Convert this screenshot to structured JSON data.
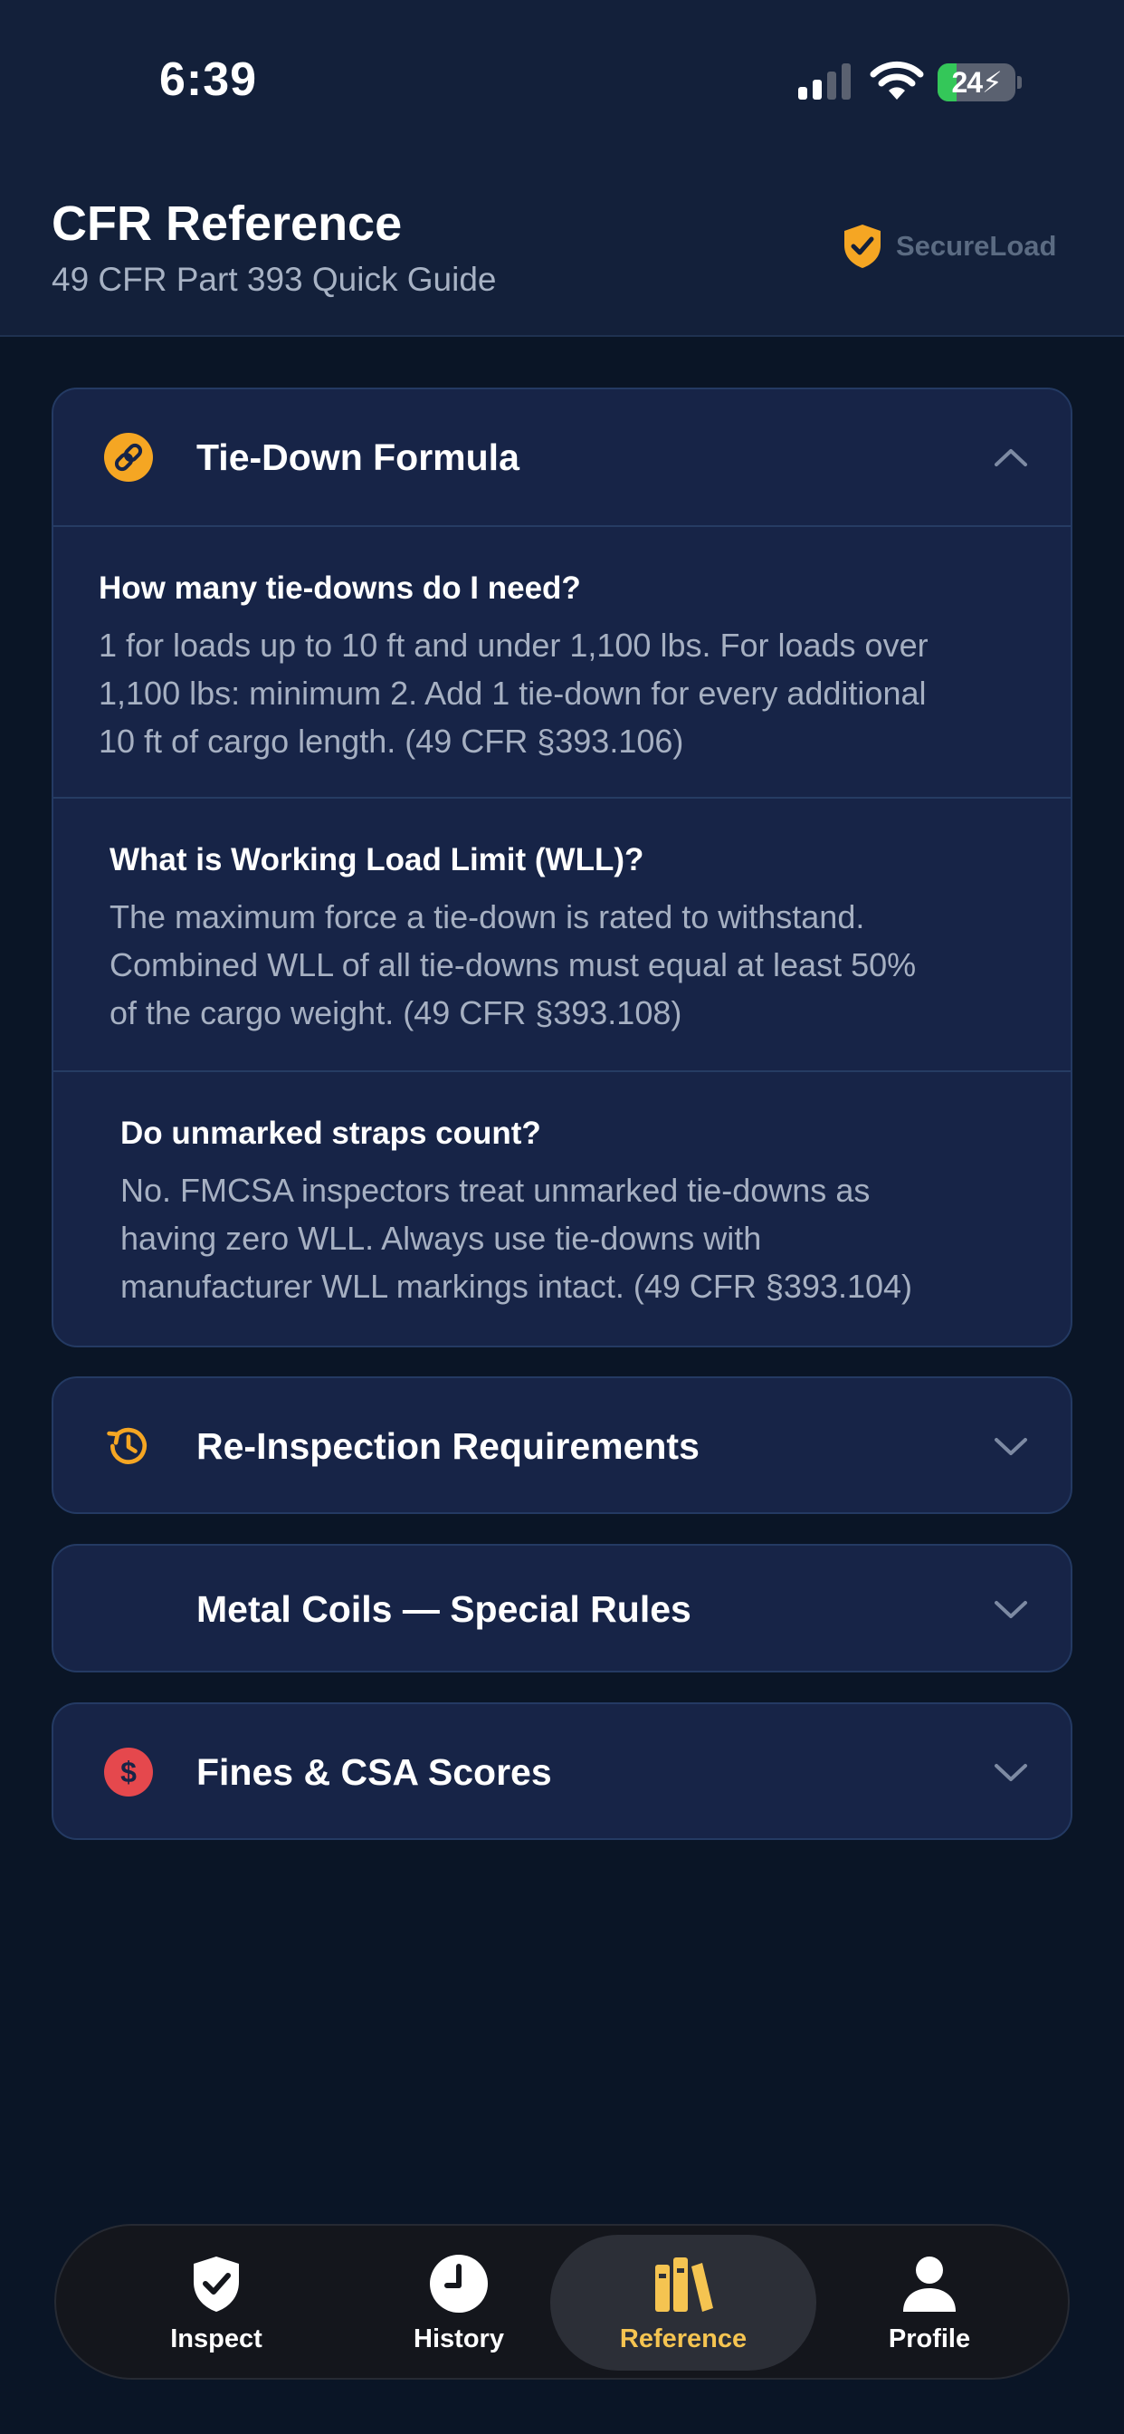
{
  "status": {
    "time": "6:39",
    "battery_level": "24",
    "battery_fraction": 0.24
  },
  "header": {
    "title": "CFR Reference",
    "subtitle": "49 CFR Part 393 Quick Guide",
    "brand": "SecureLoad"
  },
  "colors": {
    "accent": "#f5a623",
    "danger": "#e5484d",
    "active_tab": "#f5c451",
    "card_bg": "#172447"
  },
  "sections": [
    {
      "title": "Tie-Down Formula",
      "icon": "link-icon",
      "expanded": true,
      "items": [
        {
          "question": "How many tie-downs do I need?",
          "answer_lines": [
            "1 for loads up to 10 ft and under 1,100 lbs. For loads over",
            "1,100 lbs: minimum 2. Add 1 tie-down for every additional",
            "10 ft of cargo length. (49 CFR §393.106)"
          ]
        },
        {
          "question": "What is Working Load Limit (WLL)?",
          "answer_lines": [
            "The maximum force a tie-down is rated to withstand.",
            "Combined WLL of all tie-downs must equal at least 50%",
            "of the cargo weight. (49 CFR §393.108)"
          ]
        },
        {
          "question": "Do unmarked straps count?",
          "answer_lines": [
            "No. FMCSA inspectors treat unmarked tie-downs as",
            "having zero WLL. Always use tie-downs with",
            "manufacturer WLL markings intact. (49 CFR §393.104)"
          ]
        }
      ]
    },
    {
      "title": "Re-Inspection Requirements",
      "icon": "history-icon",
      "expanded": false
    },
    {
      "title": "Metal Coils — Special Rules",
      "icon": "",
      "expanded": false
    },
    {
      "title": "Fines & CSA Scores",
      "icon": "dollar-icon",
      "expanded": false
    }
  ],
  "tabs": [
    {
      "label": "Inspect",
      "icon": "shield-check-icon",
      "active": false
    },
    {
      "label": "History",
      "icon": "clock-icon",
      "active": false
    },
    {
      "label": "Reference",
      "icon": "books-icon",
      "active": true
    },
    {
      "label": "Profile",
      "icon": "person-icon",
      "active": false
    }
  ]
}
